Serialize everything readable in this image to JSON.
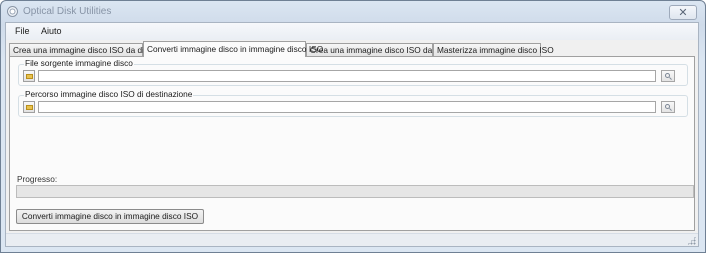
{
  "window": {
    "title": "Optical Disk Utilities",
    "close_glyph": "✕"
  },
  "menu": {
    "items": [
      {
        "label": "File"
      },
      {
        "label": "Aiuto"
      }
    ]
  },
  "tabs": [
    {
      "label": "Crea una immagine disco ISO da disco",
      "active": false
    },
    {
      "label": "Converti immagine disco in immagine disco ISO",
      "active": true
    },
    {
      "label": "Crea una immagine disco ISO da files",
      "active": false
    },
    {
      "label": "Masterizza immagine disco ISO",
      "active": false
    }
  ],
  "source_group": {
    "label": "File sorgente immagine disco",
    "value": ""
  },
  "dest_group": {
    "label": "Percorso immagine disco ISO di destinazione",
    "value": ""
  },
  "progress": {
    "label": "Progresso:",
    "value": 0
  },
  "actions": {
    "convert_label": "Converti immagine disco in immagine disco ISO"
  },
  "icons": {
    "browse": "folder-icon",
    "search": "search-icon",
    "app": "disc-icon",
    "grip": "resize-grip-icon"
  },
  "colors": {
    "progress_fill": "#37b24d",
    "folder": "#e8c24e"
  }
}
